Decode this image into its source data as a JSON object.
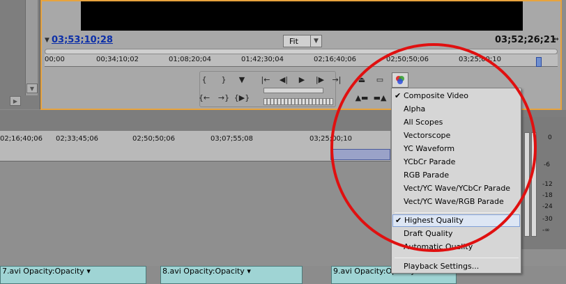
{
  "program_monitor": {
    "current_timecode": "03;53;10;28",
    "fit_label": "Fit",
    "duration_timecode": "03;52;26;21",
    "ruler_ticks": [
      "00;00",
      "00;34;10;02",
      "01;08;20;04",
      "01;42;30;04",
      "02;16;40;06",
      "02;50;50;06",
      "03;25;00;10"
    ]
  },
  "sequence": {
    "ruler_ticks": [
      "02;16;40;06",
      "02;33;45;06",
      "02;50;50;06",
      "03;07;55;08",
      "03;25;00;10"
    ],
    "clips": [
      {
        "label": "7.avi Opacity:Opacity"
      },
      {
        "label": "8.avi Opacity:Opacity"
      },
      {
        "label": "9.avi Opacity:Opacity"
      }
    ]
  },
  "meters": {
    "labels": [
      "0",
      "-6",
      "-12",
      "-18",
      "-24",
      "-30",
      "-∞"
    ]
  },
  "output_menu": {
    "items": [
      {
        "label": "Composite Video",
        "checked": true
      },
      {
        "label": "Alpha",
        "checked": false
      },
      {
        "label": "All Scopes",
        "checked": false
      },
      {
        "label": "Vectorscope",
        "checked": false
      },
      {
        "label": "YC Waveform",
        "checked": false
      },
      {
        "label": "YCbCr Parade",
        "checked": false
      },
      {
        "label": "RGB Parade",
        "checked": false
      },
      {
        "label": "Vect/YC Wave/YCbCr Parade",
        "checked": false
      },
      {
        "label": "Vect/YC Wave/RGB Parade",
        "checked": false
      }
    ],
    "quality_items": [
      {
        "label": "Highest Quality",
        "checked": true
      },
      {
        "label": "Draft Quality",
        "checked": false
      },
      {
        "label": "Automatic Quality",
        "checked": false
      }
    ],
    "settings_label": "Playback Settings..."
  },
  "colors": {
    "panel_border": "#e8a33d",
    "timecode": "#0c2fa8",
    "annotation": "#e01010",
    "clip": "#9fd4d4"
  },
  "icons": {
    "check": "✔",
    "dropdown": "▼"
  }
}
